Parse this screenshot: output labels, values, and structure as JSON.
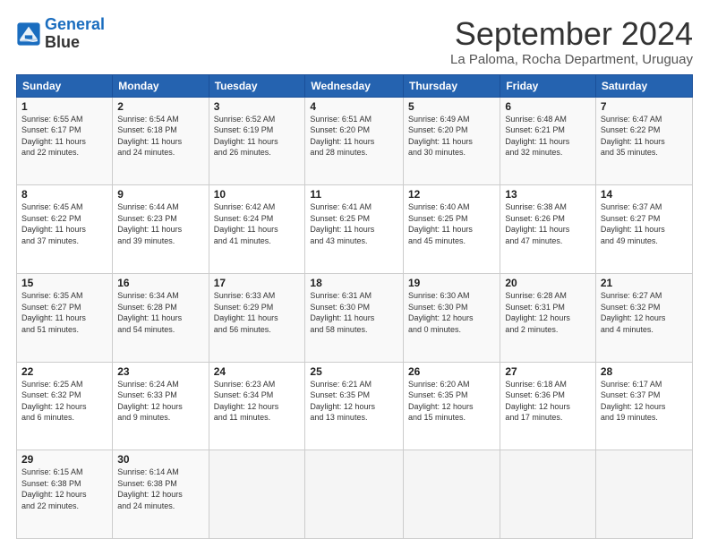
{
  "logo": {
    "line1": "General",
    "line2": "Blue"
  },
  "title": "September 2024",
  "location": "La Paloma, Rocha Department, Uruguay",
  "days_header": [
    "Sunday",
    "Monday",
    "Tuesday",
    "Wednesday",
    "Thursday",
    "Friday",
    "Saturday"
  ],
  "weeks": [
    [
      {
        "day": "1",
        "info": "Sunrise: 6:55 AM\nSunset: 6:17 PM\nDaylight: 11 hours\nand 22 minutes."
      },
      {
        "day": "2",
        "info": "Sunrise: 6:54 AM\nSunset: 6:18 PM\nDaylight: 11 hours\nand 24 minutes."
      },
      {
        "day": "3",
        "info": "Sunrise: 6:52 AM\nSunset: 6:19 PM\nDaylight: 11 hours\nand 26 minutes."
      },
      {
        "day": "4",
        "info": "Sunrise: 6:51 AM\nSunset: 6:20 PM\nDaylight: 11 hours\nand 28 minutes."
      },
      {
        "day": "5",
        "info": "Sunrise: 6:49 AM\nSunset: 6:20 PM\nDaylight: 11 hours\nand 30 minutes."
      },
      {
        "day": "6",
        "info": "Sunrise: 6:48 AM\nSunset: 6:21 PM\nDaylight: 11 hours\nand 32 minutes."
      },
      {
        "day": "7",
        "info": "Sunrise: 6:47 AM\nSunset: 6:22 PM\nDaylight: 11 hours\nand 35 minutes."
      }
    ],
    [
      {
        "day": "8",
        "info": "Sunrise: 6:45 AM\nSunset: 6:22 PM\nDaylight: 11 hours\nand 37 minutes."
      },
      {
        "day": "9",
        "info": "Sunrise: 6:44 AM\nSunset: 6:23 PM\nDaylight: 11 hours\nand 39 minutes."
      },
      {
        "day": "10",
        "info": "Sunrise: 6:42 AM\nSunset: 6:24 PM\nDaylight: 11 hours\nand 41 minutes."
      },
      {
        "day": "11",
        "info": "Sunrise: 6:41 AM\nSunset: 6:25 PM\nDaylight: 11 hours\nand 43 minutes."
      },
      {
        "day": "12",
        "info": "Sunrise: 6:40 AM\nSunset: 6:25 PM\nDaylight: 11 hours\nand 45 minutes."
      },
      {
        "day": "13",
        "info": "Sunrise: 6:38 AM\nSunset: 6:26 PM\nDaylight: 11 hours\nand 47 minutes."
      },
      {
        "day": "14",
        "info": "Sunrise: 6:37 AM\nSunset: 6:27 PM\nDaylight: 11 hours\nand 49 minutes."
      }
    ],
    [
      {
        "day": "15",
        "info": "Sunrise: 6:35 AM\nSunset: 6:27 PM\nDaylight: 11 hours\nand 51 minutes."
      },
      {
        "day": "16",
        "info": "Sunrise: 6:34 AM\nSunset: 6:28 PM\nDaylight: 11 hours\nand 54 minutes."
      },
      {
        "day": "17",
        "info": "Sunrise: 6:33 AM\nSunset: 6:29 PM\nDaylight: 11 hours\nand 56 minutes."
      },
      {
        "day": "18",
        "info": "Sunrise: 6:31 AM\nSunset: 6:30 PM\nDaylight: 11 hours\nand 58 minutes."
      },
      {
        "day": "19",
        "info": "Sunrise: 6:30 AM\nSunset: 6:30 PM\nDaylight: 12 hours\nand 0 minutes."
      },
      {
        "day": "20",
        "info": "Sunrise: 6:28 AM\nSunset: 6:31 PM\nDaylight: 12 hours\nand 2 minutes."
      },
      {
        "day": "21",
        "info": "Sunrise: 6:27 AM\nSunset: 6:32 PM\nDaylight: 12 hours\nand 4 minutes."
      }
    ],
    [
      {
        "day": "22",
        "info": "Sunrise: 6:25 AM\nSunset: 6:32 PM\nDaylight: 12 hours\nand 6 minutes."
      },
      {
        "day": "23",
        "info": "Sunrise: 6:24 AM\nSunset: 6:33 PM\nDaylight: 12 hours\nand 9 minutes."
      },
      {
        "day": "24",
        "info": "Sunrise: 6:23 AM\nSunset: 6:34 PM\nDaylight: 12 hours\nand 11 minutes."
      },
      {
        "day": "25",
        "info": "Sunrise: 6:21 AM\nSunset: 6:35 PM\nDaylight: 12 hours\nand 13 minutes."
      },
      {
        "day": "26",
        "info": "Sunrise: 6:20 AM\nSunset: 6:35 PM\nDaylight: 12 hours\nand 15 minutes."
      },
      {
        "day": "27",
        "info": "Sunrise: 6:18 AM\nSunset: 6:36 PM\nDaylight: 12 hours\nand 17 minutes."
      },
      {
        "day": "28",
        "info": "Sunrise: 6:17 AM\nSunset: 6:37 PM\nDaylight: 12 hours\nand 19 minutes."
      }
    ],
    [
      {
        "day": "29",
        "info": "Sunrise: 6:15 AM\nSunset: 6:38 PM\nDaylight: 12 hours\nand 22 minutes."
      },
      {
        "day": "30",
        "info": "Sunrise: 6:14 AM\nSunset: 6:38 PM\nDaylight: 12 hours\nand 24 minutes."
      },
      null,
      null,
      null,
      null,
      null
    ]
  ]
}
